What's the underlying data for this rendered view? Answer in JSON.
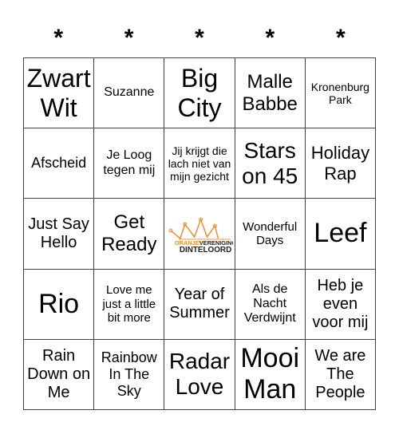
{
  "header": [
    "*",
    "*",
    "*",
    "*",
    "*"
  ],
  "cells": [
    {
      "text": "Zwart Wit",
      "size": "s32"
    },
    {
      "text": "Suzanne",
      "size": "s16"
    },
    {
      "text": "Big City",
      "size": "s32"
    },
    {
      "text": "Malle Babbe",
      "size": "s24"
    },
    {
      "text": "Kronenburg Park",
      "size": "s14"
    },
    {
      "text": "Afscheid",
      "size": "s18"
    },
    {
      "text": "Je Loog tegen mij",
      "size": "s16"
    },
    {
      "text": "Jij krijgt die lach niet van mijn gezicht",
      "size": "s14"
    },
    {
      "text": "Stars on 45",
      "size": "s28"
    },
    {
      "text": "Holiday Rap",
      "size": "s22"
    },
    {
      "text": "Just Say Hello",
      "size": "s20"
    },
    {
      "text": "Get Ready",
      "size": "s24"
    },
    {
      "logo": true,
      "logo_text_top": "ORANJEVERENIGING",
      "logo_text_bottom": "DINTELOORD"
    },
    {
      "text": "Wonderful Days",
      "size": "s15"
    },
    {
      "text": "Leef",
      "size": "s34"
    },
    {
      "text": "Rio",
      "size": "s34"
    },
    {
      "text": "Love me just a little bit more",
      "size": "s15"
    },
    {
      "text": "Year of Summer",
      "size": "s20"
    },
    {
      "text": "Als de Nacht Verdwijnt",
      "size": "s16"
    },
    {
      "text": "Heb je even voor mij",
      "size": "s20"
    },
    {
      "text": "Rain Down on Me",
      "size": "s20"
    },
    {
      "text": "Rainbow In The Sky",
      "size": "s18"
    },
    {
      "text": "Radar Love",
      "size": "s28"
    },
    {
      "text": "Mooi Man",
      "size": "s34"
    },
    {
      "text": "We are The People",
      "size": "s20"
    }
  ],
  "colors": {
    "logo_orange": "#f28c28",
    "logo_dark": "#222222",
    "grid_line": "#444444"
  }
}
